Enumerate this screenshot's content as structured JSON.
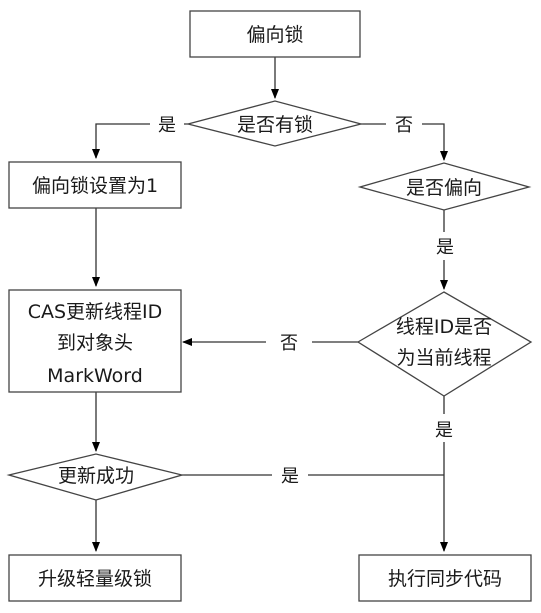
{
  "nodes": {
    "biased_lock": "偏向锁",
    "has_lock": "是否有锁",
    "set_biased_flag": "偏向锁设置为1",
    "is_biased": "是否偏向",
    "cas_update": [
      "CAS更新线程ID",
      "到对象头",
      "MarkWord"
    ],
    "thread_is_current": [
      "线程ID是否",
      "为当前线程"
    ],
    "update_success": "更新成功",
    "upgrade_lightweight": "升级轻量级锁",
    "execute_sync": "执行同步代码"
  },
  "edges": {
    "has_lock_yes": "是",
    "has_lock_no": "否",
    "is_biased_yes": "是",
    "thread_current_no": "否",
    "thread_current_yes": "是",
    "update_success_yes": "是"
  }
}
